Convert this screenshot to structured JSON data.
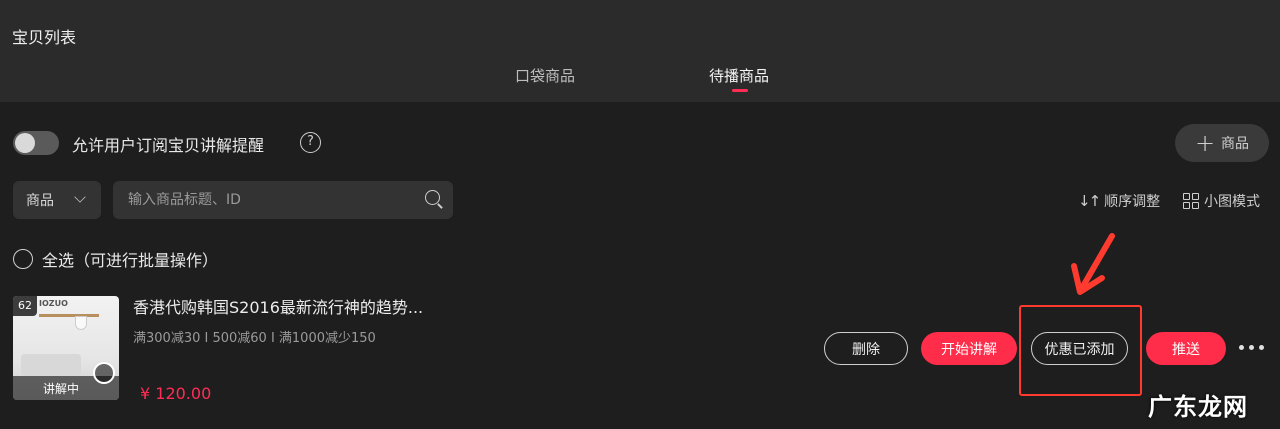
{
  "header": {
    "title": "宝贝列表",
    "tabs": [
      {
        "label": "口袋商品",
        "active": false
      },
      {
        "label": "待播商品",
        "active": true
      }
    ]
  },
  "controls": {
    "toggle_label": "允许用户订阅宝贝讲解提醒",
    "toggle_on": false,
    "help_symbol": "?",
    "add_product_label": "商品",
    "category_value": "商品",
    "search_placeholder": "输入商品标题、ID",
    "sort_label": "顺序调整",
    "view_mode_label": "小图模式",
    "select_all_label": "全选（可进行批量操作）"
  },
  "product": {
    "rank": "62",
    "thumb_brand": "IOZUO",
    "status_badge": "讲解中",
    "title": "香港代购韩国S2016最新流行神的趋势...",
    "promo": "满300减30 I 500减60 I 满1000减少150",
    "price": "¥ 120.00",
    "actions": {
      "delete": "删除",
      "start_explain": "开始讲解",
      "coupon_added": "优惠已添加",
      "push": "推送"
    }
  },
  "annotation": {
    "color": "#ff3b30"
  },
  "watermark": "广东龙网",
  "colors": {
    "accent": "#ff2d4a",
    "price": "#ff2d55",
    "panel_top": "#2b2b2b",
    "panel_main": "#1e1e1e"
  }
}
